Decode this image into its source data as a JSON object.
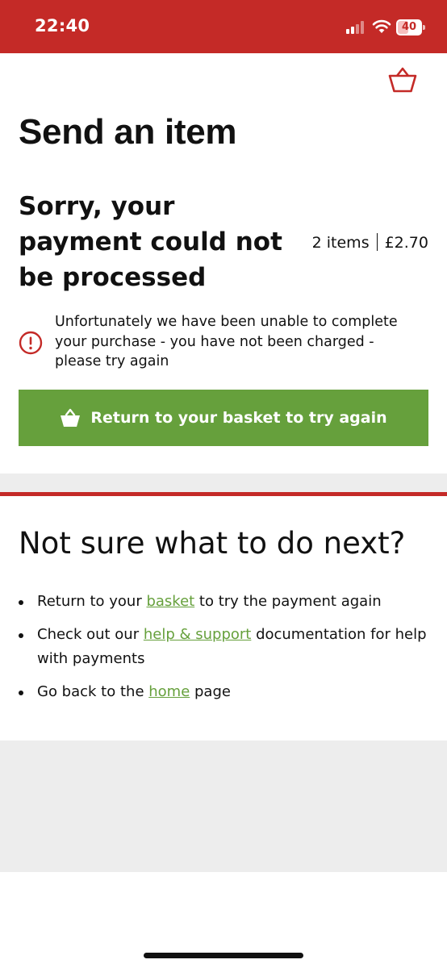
{
  "status_bar": {
    "time": "22:40",
    "battery": "40",
    "background": "#c42a27"
  },
  "header": {
    "basket_icon": "basket-icon"
  },
  "page": {
    "title": "Send an item"
  },
  "error": {
    "heading": "Sorry, your payment could not be processed",
    "items": "2 items",
    "total": "£2.70",
    "message": "Unfortunately we have been unable to complete your purchase - you have not been charged - please try again",
    "icon": "alert-circle-icon",
    "icon_color": "#c42a27"
  },
  "cta": {
    "label": "Return to your basket to try again",
    "icon": "basket-icon",
    "color": "#66a03c"
  },
  "next": {
    "heading": "Not sure what to do next?",
    "items": [
      {
        "before": "Return to your ",
        "link": "basket",
        "after": " to try the payment again"
      },
      {
        "before": "Check out our ",
        "link": "help & support",
        "after": " documentation for help with payments"
      },
      {
        "before": "Go back to the ",
        "link": "home",
        "after": " page"
      }
    ],
    "link_color": "#66a03c"
  }
}
